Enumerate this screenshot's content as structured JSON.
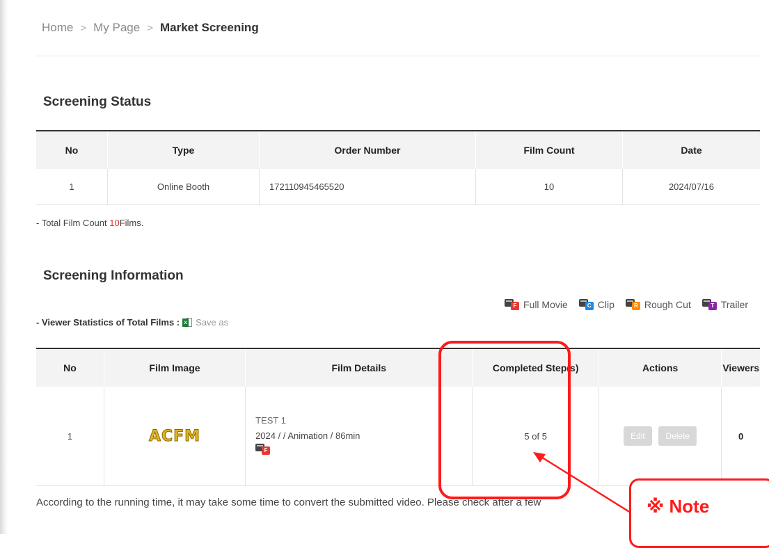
{
  "breadcrumb": {
    "home": "Home",
    "my_page": "My Page",
    "current": "Market Screening",
    "separator": ">"
  },
  "screening_status": {
    "title": "Screening Status",
    "columns": [
      "No",
      "Type",
      "Order Number",
      "Film Count",
      "Date"
    ],
    "rows": [
      {
        "no": "1",
        "type": "Online Booth",
        "order_number": "172110945465520",
        "film_count": "10",
        "date": "2024/07/16"
      }
    ],
    "total_prefix": "- Total Film Count ",
    "total_value": "10",
    "total_suffix": "Films."
  },
  "screening_information": {
    "title": "Screening Information",
    "legend": [
      {
        "label": "Full Movie",
        "letter": "F",
        "color": "#e53935"
      },
      {
        "label": "Clip",
        "letter": "C",
        "color": "#1e88e5"
      },
      {
        "label": "Rough Cut",
        "letter": "R",
        "color": "#fb8c00"
      },
      {
        "label": "Trailer",
        "letter": "T",
        "color": "#8e24aa"
      }
    ],
    "viewer_stats_label": "- Viewer Statistics of Total Films : ",
    "save_as": "Save as",
    "columns": [
      "No",
      "Film Image",
      "Film Details",
      "Completed Step(s)",
      "Actions",
      "Viewers"
    ],
    "rows": [
      {
        "no": "1",
        "image_logo": "ACFM",
        "title": "TEST 1",
        "meta": "2024 / / Animation / 86min",
        "type_letter": "F",
        "completed": "5 of 5",
        "edit": "Edit",
        "delete": "Delete",
        "viewers": "0"
      }
    ]
  },
  "notice": "According to the running time, it may take some time to convert the submitted video. Please check after a few",
  "annotation": {
    "note": "※ Note",
    "color": "#ff1a1a"
  }
}
